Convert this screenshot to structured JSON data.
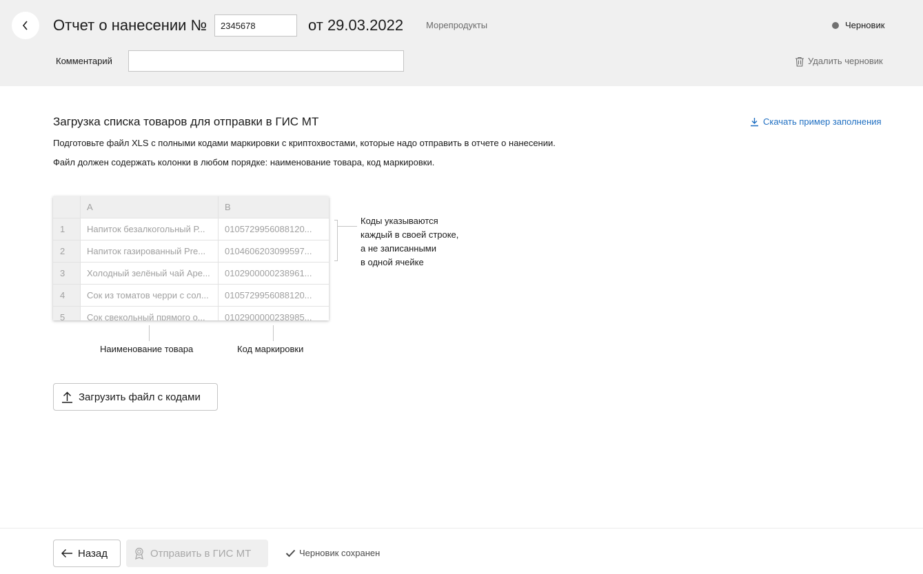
{
  "header": {
    "title": "Отчет о нанесении №",
    "report_number": "2345678",
    "date": "от 29.03.2022",
    "category": "Морепродукты",
    "status": "Черновик",
    "comment_label": "Комментарий",
    "comment_value": "",
    "delete_draft": "Удалить черновик"
  },
  "main": {
    "section_title": "Загрузка списка товаров для отправки в ГИС МТ",
    "download_link": "Скачать пример заполнения",
    "description_1": "Подготовьте файл XLS с полными кодами маркировки с криптохвостами, которые надо отправить в отчете о нанесении.",
    "description_2": "Файл должен содержать колонки в любом порядке: наименование товара, код маркировки.",
    "sheet": {
      "columns": [
        "A",
        "B"
      ],
      "rows": [
        {
          "num": "1",
          "a": "Напиток безалкогольный Р...",
          "b": "0105729956088120..."
        },
        {
          "num": "2",
          "a": "Напиток газированный Pre...",
          "b": "0104606203099597..."
        },
        {
          "num": "3",
          "a": "Холодный зелёный чай Аpe...",
          "b": "0102900000238961..."
        },
        {
          "num": "4",
          "a": "Сок из томатов черри с сол...",
          "b": "0105729956088120..."
        },
        {
          "num": "5",
          "a": "Сок свекольный прямого о...",
          "b": "0102900000238985..."
        }
      ]
    },
    "note": [
      "Коды указываются",
      "каждый в своей строке,",
      "а не записанными",
      "в одной ячейке"
    ],
    "label_name": "Наименование товара",
    "label_code": "Код маркировки",
    "upload_button": "Загрузить файл с кодами"
  },
  "footer": {
    "back_button": "Назад",
    "send_button": "Отправить в ГИС МТ",
    "saved_status": "Черновик сохранен"
  },
  "colors": {
    "header_bg": "#f0f0f0",
    "link": "#1f6fc2",
    "status_dot": "#707070",
    "disabled_text": "#a8a8a8"
  },
  "icons": [
    "chevron-left-icon",
    "trash-icon",
    "download-icon",
    "upload-icon",
    "arrow-left-icon",
    "award-icon",
    "check-icon"
  ]
}
